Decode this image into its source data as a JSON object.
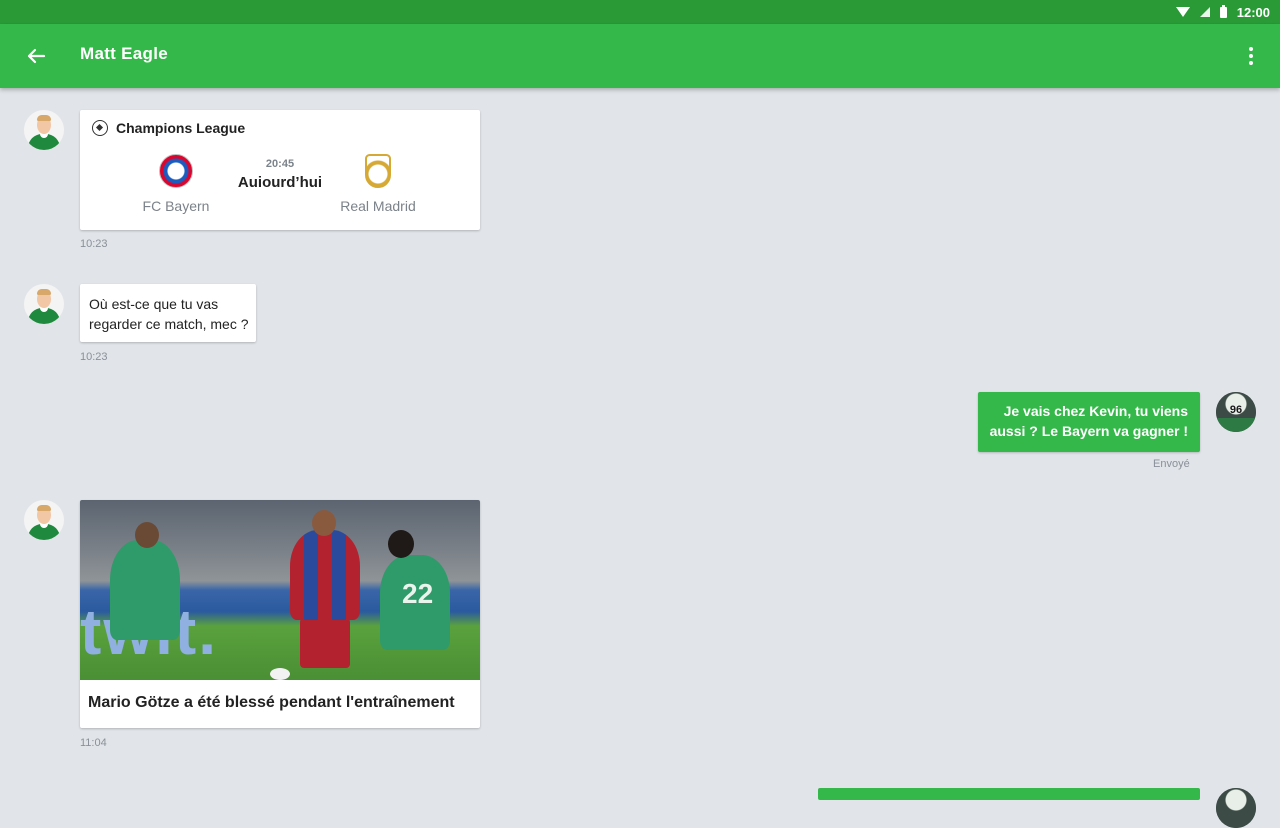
{
  "status_bar": {
    "time": "12:00"
  },
  "app_bar": {
    "title": "Matt Eagle"
  },
  "messages": {
    "match_card": {
      "league": "Champions League",
      "home_team": "FC Bayern",
      "away_team": "Real Madrid",
      "kickoff_time": "20:45",
      "kickoff_day": "Auiourd’hui",
      "timestamp": "10:23"
    },
    "incoming_1": {
      "line1": "Où est-ce que tu vas",
      "line2": "regarder ce match, mec ?",
      "timestamp": "10:23"
    },
    "outgoing_1": {
      "line1": "Je vais chez Kevin, tu viens",
      "line2": "aussi ? Le Bayern va gagner !",
      "status": "Envoyé"
    },
    "news_card": {
      "image_ad_text": "twit.",
      "player_number": "22",
      "title": "Mario Götze a été blessé pendant l'entraînement",
      "timestamp": "11:04"
    }
  },
  "colors": {
    "accent": "#35b84a",
    "status_bar": "#2a9a37",
    "background": "#e1e5e9"
  }
}
